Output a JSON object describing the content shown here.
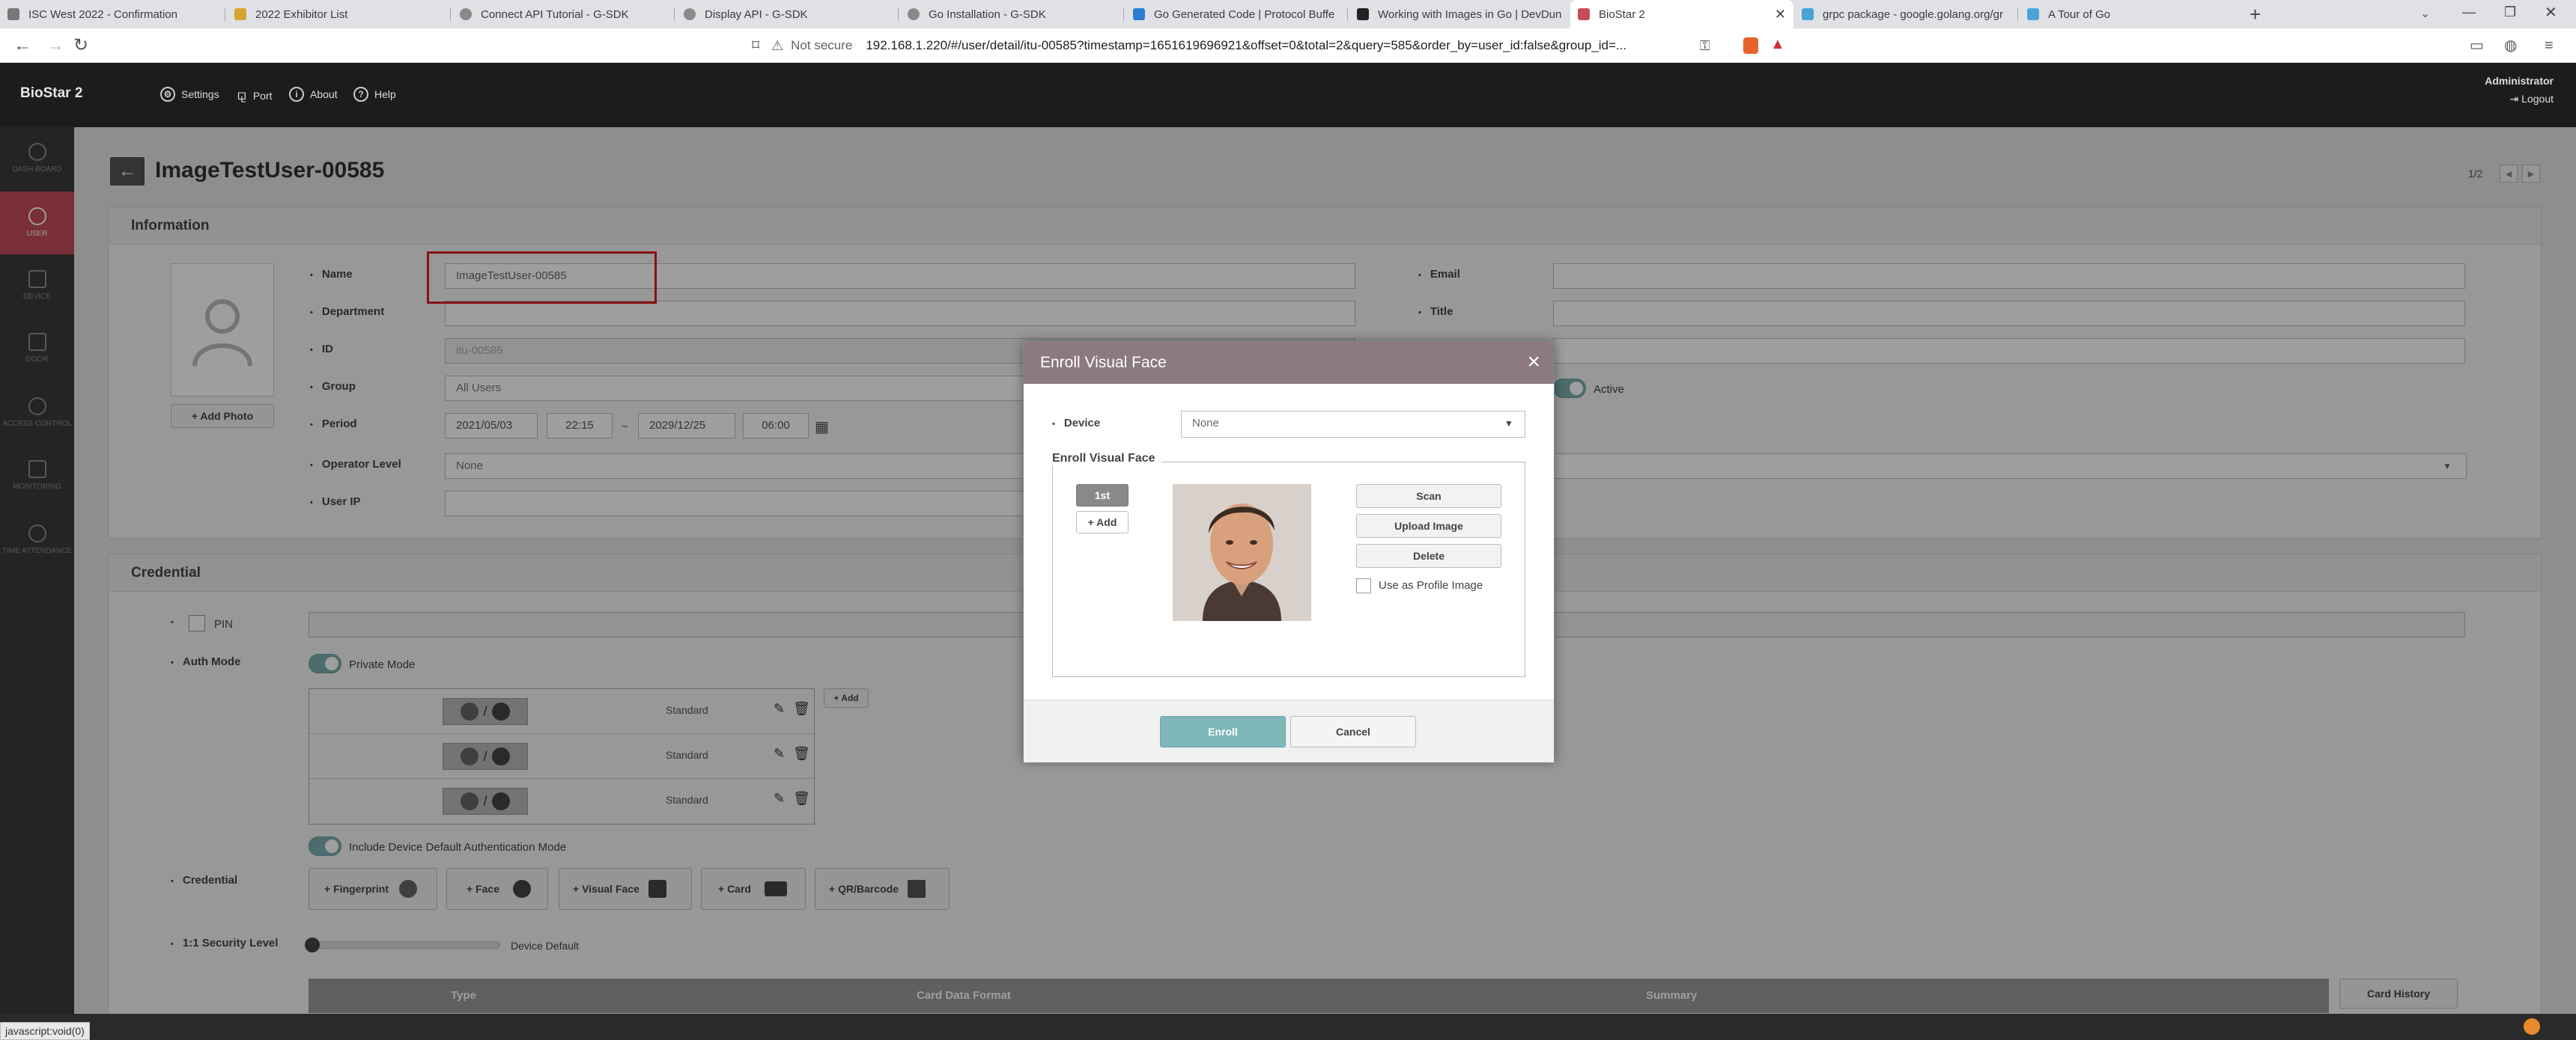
{
  "browser": {
    "tabs": [
      {
        "label": "ISC West 2022 - Confirmation"
      },
      {
        "label": "2022 Exhibitor List"
      },
      {
        "label": "Connect API Tutorial - G-SDK"
      },
      {
        "label": "Display API - G-SDK"
      },
      {
        "label": "Go Installation - G-SDK"
      },
      {
        "label": "Go Generated Code | Protocol Buffe"
      },
      {
        "label": "Working with Images in Go | DevDun"
      },
      {
        "label": "BioStar 2"
      },
      {
        "label": "grpc package - google.golang.org/gr"
      },
      {
        "label": "A Tour of Go"
      }
    ],
    "new_tab": "+",
    "not_secure": "Not secure",
    "url": "192.168.1.220/#/user/detail/itu-00585?timestamp=1651619696921&offset=0&total=2&query=585&order_by=user_id:false&group_id=...",
    "status_url": "javascript:void(0)"
  },
  "app": {
    "brand": "BioStar 2",
    "nav": {
      "settings": "Settings",
      "port": "Port",
      "about": "About",
      "help": "Help"
    },
    "user": {
      "name": "Administrator",
      "logout": "Logout"
    },
    "sidebar": [
      {
        "label": "DASH BOARD"
      },
      {
        "label": "USER"
      },
      {
        "label": "DEVICE"
      },
      {
        "label": "DOOR"
      },
      {
        "label": "ACCESS CONTROL"
      },
      {
        "label": "MONITORING"
      },
      {
        "label": "TIME ATTENDANCE"
      }
    ]
  },
  "page": {
    "title": "ImageTestUser-00585",
    "pager": "1/2",
    "information": {
      "heading": "Information",
      "add_photo": "+ Add Photo",
      "labels": {
        "name": "Name",
        "department": "Department",
        "id": "ID",
        "group": "Group",
        "period": "Period",
        "operator_level": "Operator Level",
        "user_ip": "User IP",
        "email": "Email",
        "title": "Title"
      },
      "values": {
        "name": "ImageTestUser-00585",
        "id": "itu-00585",
        "group": "All Users",
        "period_start_date": "2021/05/03",
        "period_start_time": "22:15",
        "period_sep": "~",
        "period_end_date": "2029/12/25",
        "period_end_time": "06:00",
        "operator_level": "None"
      },
      "status": "Active"
    },
    "credential": {
      "heading": "Credential",
      "pin_label": "PIN",
      "auth_mode_label": "Auth Mode",
      "private_mode": "Private Mode",
      "auth_rows": [
        {
          "level": "Standard"
        },
        {
          "level": "Standard"
        },
        {
          "level": "Standard"
        }
      ],
      "add": "+ Add",
      "include_default": "Include Device Default Authentication Mode",
      "credential_label": "Credential",
      "buttons": {
        "fingerprint": "+ Fingerprint",
        "face": "+ Face",
        "visual_face": "+ Visual Face",
        "card": "+ Card",
        "qr": "+ QR/Barcode"
      },
      "security_label": "1:1 Security Level",
      "security_value": "Device Default",
      "card_history": "Card History",
      "table_headers": [
        "Type",
        "Card Data Format",
        "Summary"
      ]
    }
  },
  "modal": {
    "title": "Enroll Visual Face",
    "device_label": "Device",
    "device_value": "None",
    "section_title": "Enroll Visual Face",
    "slot_first": "1st",
    "slot_add": "+ Add",
    "scan": "Scan",
    "upload": "Upload Image",
    "delete": "Delete",
    "use_as_profile": "Use as Profile Image",
    "enroll": "Enroll",
    "cancel": "Cancel"
  }
}
